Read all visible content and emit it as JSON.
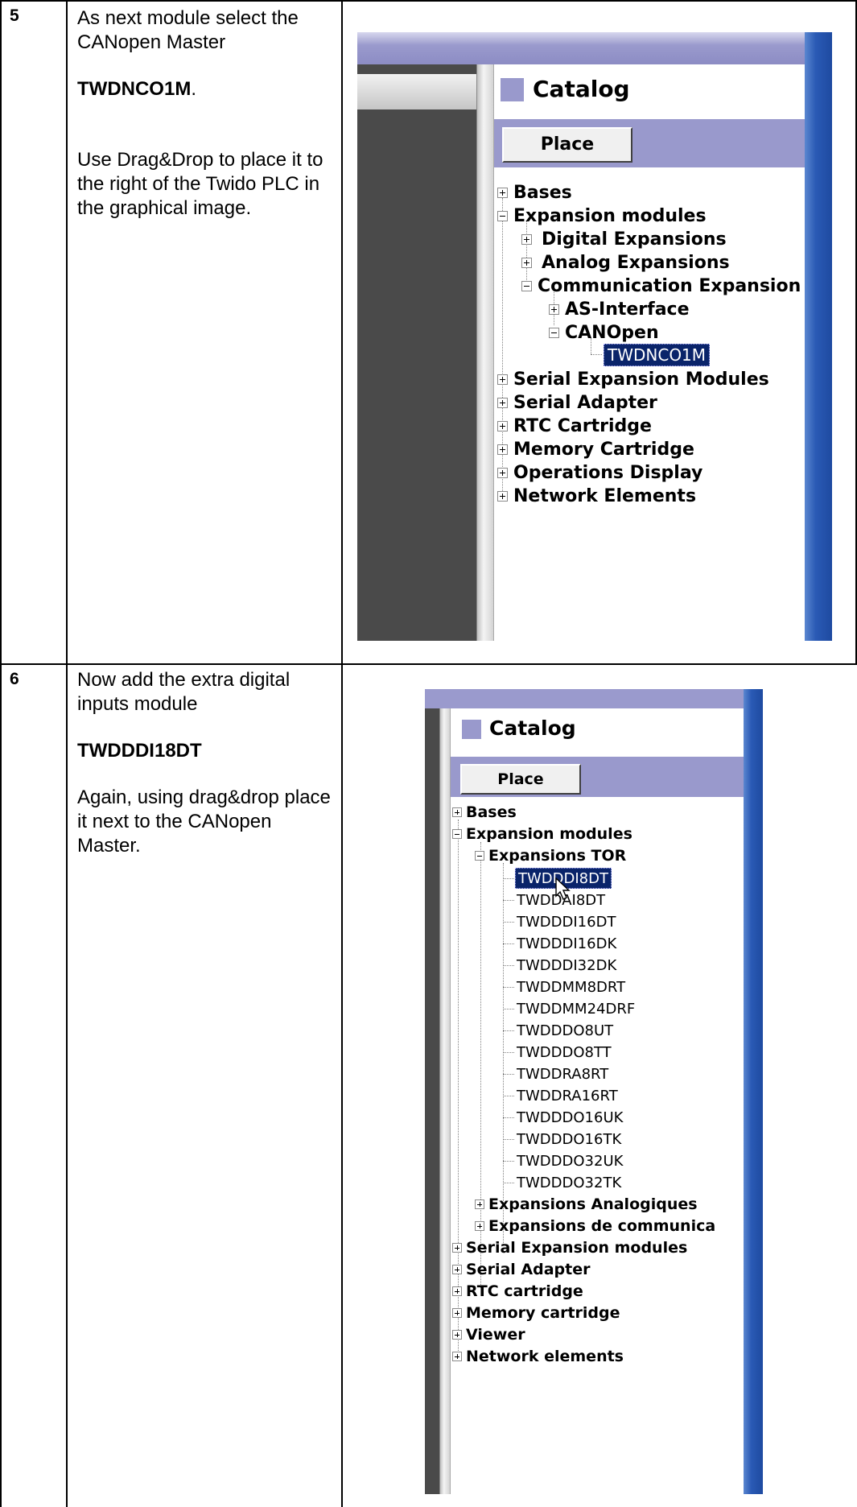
{
  "step5": {
    "number": "5",
    "text_line1": "As next module select the CANopen Master",
    "module": "TWDNCO1M",
    "module_suffix": ".",
    "text_line2": "Use Drag&Drop to place it to the right of the Twido PLC in the graphical image.",
    "screenshot": {
      "catalog_title": "Catalog",
      "place_button": "Place",
      "tree": [
        {
          "label": "Bases",
          "state": "collapsed"
        },
        {
          "label": "Expansion modules",
          "state": "expanded"
        },
        {
          "label": "Digital Expansions",
          "state": "collapsed"
        },
        {
          "label": "Analog Expansions",
          "state": "collapsed"
        },
        {
          "label": "Communication Expansion",
          "state": "expanded"
        },
        {
          "label": "AS-Interface",
          "state": "collapsed"
        },
        {
          "label": "CANOpen",
          "state": "expanded"
        },
        {
          "label": "TWDNCO1M",
          "state": "selected"
        },
        {
          "label": "Serial Expansion Modules",
          "state": "collapsed"
        },
        {
          "label": "Serial Adapter",
          "state": "collapsed"
        },
        {
          "label": "RTC Cartridge",
          "state": "collapsed"
        },
        {
          "label": "Memory Cartridge",
          "state": "collapsed"
        },
        {
          "label": "Operations Display",
          "state": "collapsed"
        },
        {
          "label": "Network Elements",
          "state": "collapsed"
        }
      ]
    }
  },
  "step6": {
    "number": "6",
    "text_line1": "Now add the extra digital inputs module",
    "module": "TWDDDI18DT",
    "text_line2": "Again, using drag&drop place it next to the CANopen Master.",
    "screenshot": {
      "catalog_title": "Catalog",
      "place_button": "Place",
      "tree": [
        {
          "label": "Bases",
          "state": "collapsed"
        },
        {
          "label": "Expansion modules",
          "state": "expanded"
        },
        {
          "label": "Expansions TOR",
          "state": "expanded"
        },
        {
          "label": "TWDDDI8DT",
          "state": "selected"
        },
        {
          "label": "TWDDAI8DT",
          "state": "leaf"
        },
        {
          "label": "TWDDDI16DT",
          "state": "leaf"
        },
        {
          "label": "TWDDDI16DK",
          "state": "leaf"
        },
        {
          "label": "TWDDDI32DK",
          "state": "leaf"
        },
        {
          "label": "TWDDMM8DRT",
          "state": "leaf"
        },
        {
          "label": "TWDDMM24DRF",
          "state": "leaf"
        },
        {
          "label": "TWDDDO8UT",
          "state": "leaf"
        },
        {
          "label": "TWDDDO8TT",
          "state": "leaf"
        },
        {
          "label": "TWDDRA8RT",
          "state": "leaf"
        },
        {
          "label": "TWDDRA16RT",
          "state": "leaf"
        },
        {
          "label": "TWDDDO16UK",
          "state": "leaf"
        },
        {
          "label": "TWDDDO16TK",
          "state": "leaf"
        },
        {
          "label": "TWDDDO32UK",
          "state": "leaf"
        },
        {
          "label": "TWDDDO32TK",
          "state": "leaf"
        },
        {
          "label": "Expansions Analogiques",
          "state": "collapsed"
        },
        {
          "label": "Expansions de communica",
          "state": "collapsed"
        },
        {
          "label": "Serial Expansion modules",
          "state": "collapsed"
        },
        {
          "label": "Serial Adapter",
          "state": "collapsed"
        },
        {
          "label": "RTC cartridge",
          "state": "collapsed"
        },
        {
          "label": "Memory cartridge",
          "state": "collapsed"
        },
        {
          "label": "Viewer",
          "state": "collapsed"
        },
        {
          "label": "Network elements",
          "state": "collapsed"
        }
      ]
    }
  },
  "colors": {
    "title_bar": "#9999cc",
    "catalog_swatch": "#9999cc",
    "selection": "#0a246a",
    "side_strip": "#2a5ab5",
    "dark_panel": "#4a4a4a"
  }
}
